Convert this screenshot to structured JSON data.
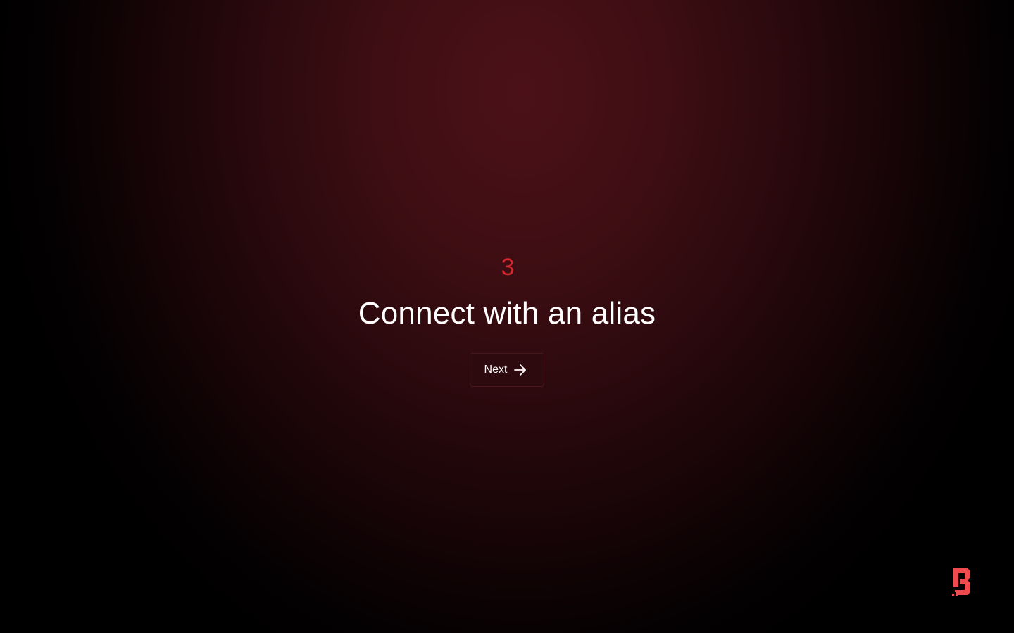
{
  "step": {
    "number": "3",
    "title": "Connect with an alias"
  },
  "actions": {
    "next_label": "Next",
    "next_icon": "arrow-right-icon"
  },
  "branding": {
    "logo_icon": "brand-logo-icon"
  },
  "colors": {
    "accent": "#d3262d",
    "logo": "#ef4b4f",
    "background_glow": "#4c1118",
    "background_edge": "#000000",
    "button_background": "#2c0a0d",
    "text": "#ffffff"
  }
}
